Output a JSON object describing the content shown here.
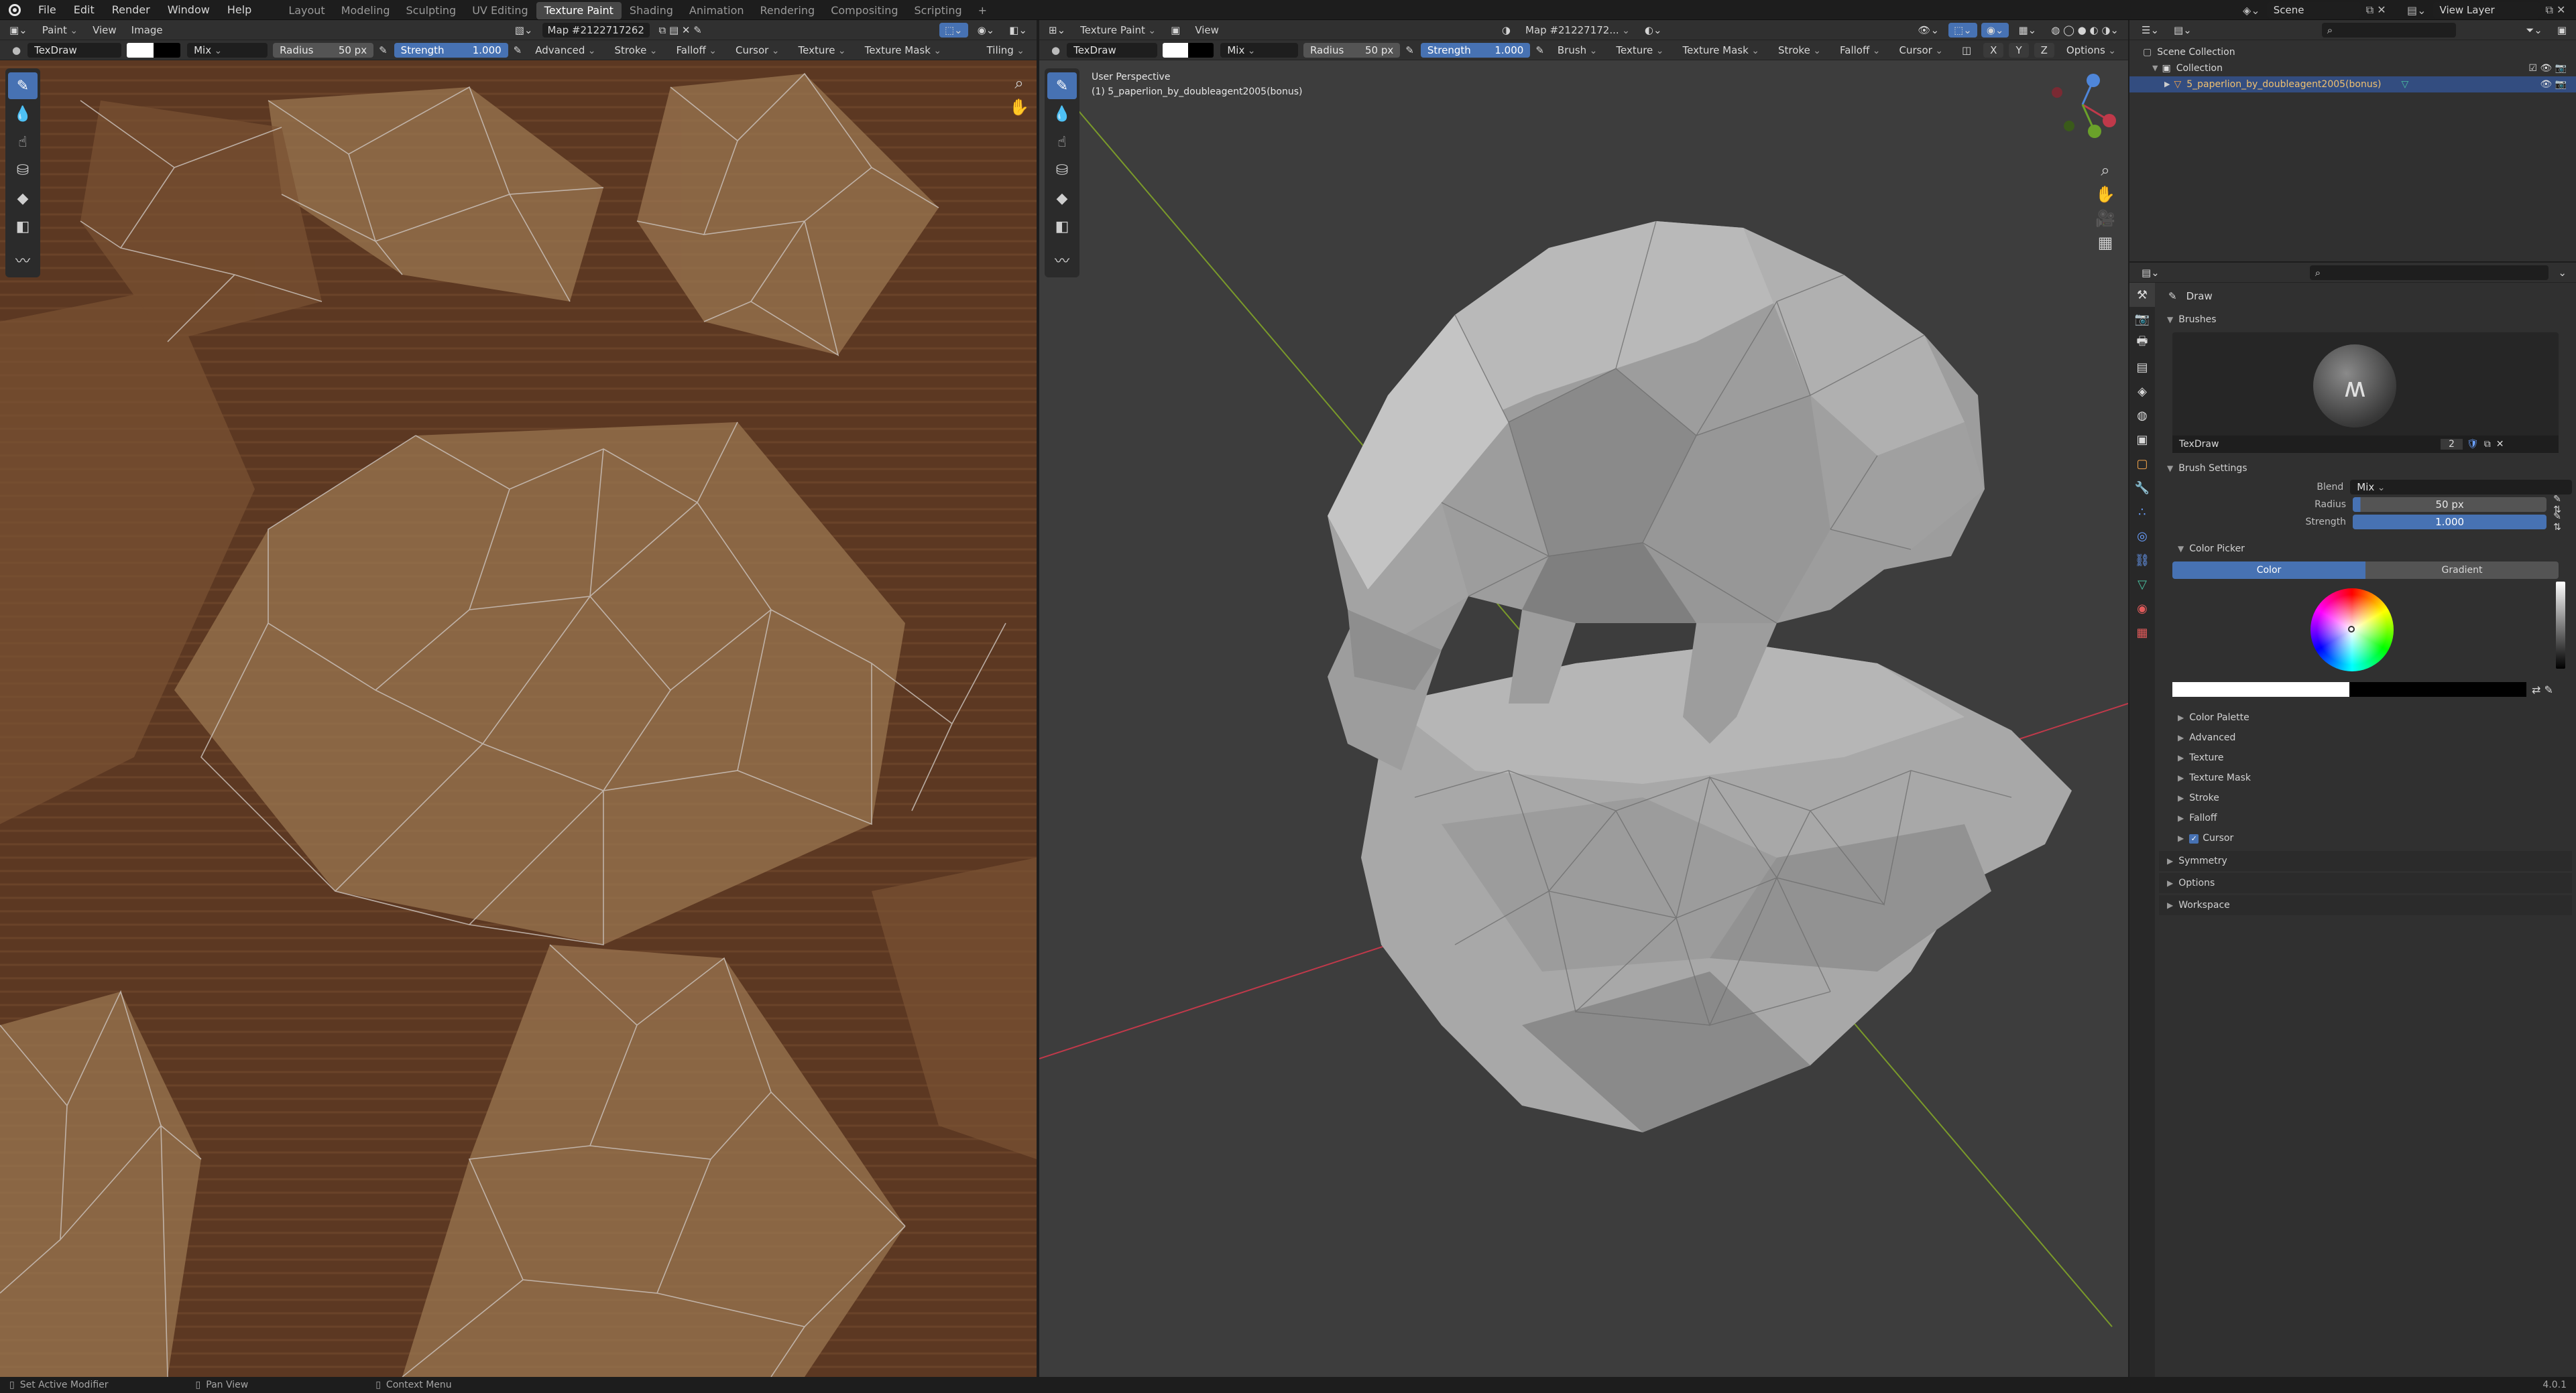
{
  "topbar": {
    "menus": [
      "File",
      "Edit",
      "Render",
      "Window",
      "Help"
    ],
    "workspaces": [
      "Layout",
      "Modeling",
      "Sculpting",
      "UV Editing",
      "Texture Paint",
      "Shading",
      "Animation",
      "Rendering",
      "Compositing",
      "Scripting"
    ],
    "active_workspace": "Texture Paint",
    "add_tab": "+",
    "scene": "Scene",
    "view_layer": "View Layer"
  },
  "image_editor": {
    "mode": "Paint",
    "menus": [
      "View",
      "Image"
    ],
    "image_name": "Map #2122717262",
    "tiling": "Tiling",
    "tool": {
      "brush": "TexDraw",
      "blend": "Mix",
      "radius_label": "Radius",
      "radius_value": "50 px",
      "strength_label": "Strength",
      "strength_value": "1.000",
      "menus": [
        "Advanced",
        "Stroke",
        "Falloff",
        "Cursor",
        "Texture",
        "Texture Mask"
      ]
    }
  },
  "viewport": {
    "mode": "Texture Paint",
    "menus": [
      "View"
    ],
    "image_name": "Map #21227172...",
    "perspective_label": "User Perspective",
    "object_label": "(1) 5_paperlion_by_doubleagent2005(bonus)",
    "options": "Options",
    "axes": [
      "X",
      "Y",
      "Z"
    ],
    "tool": {
      "brush": "TexDraw",
      "blend": "Mix",
      "radius_label": "Radius",
      "radius_value": "50 px",
      "strength_label": "Strength",
      "strength_value": "1.000",
      "menus": [
        "Brush",
        "Texture",
        "Texture Mask",
        "Stroke",
        "Falloff",
        "Cursor"
      ]
    }
  },
  "outliner": {
    "scene_collection": "Scene Collection",
    "collection": "Collection",
    "object": "5_paperlion_by_doubleagent2005(bonus)"
  },
  "properties": {
    "tool_name": "Draw",
    "brushes_header": "Brushes",
    "brush_name": "TexDraw",
    "brush_users": "2",
    "brush_settings_header": "Brush Settings",
    "blend_label": "Blend",
    "blend_value": "Mix",
    "radius_label": "Radius",
    "radius_value": "50 px",
    "strength_label": "Strength",
    "strength_value": "1.000",
    "color_picker_header": "Color Picker",
    "color_tab": "Color",
    "gradient_tab": "Gradient",
    "subpanels": [
      "Color Palette",
      "Advanced",
      "Texture",
      "Texture Mask",
      "Stroke",
      "Falloff",
      "Cursor"
    ],
    "sections": [
      "Symmetry",
      "Options",
      "Workspace"
    ]
  },
  "statusbar": {
    "hint1": "Set Active Modifier",
    "hint2": "Pan View",
    "hint3": "Context Menu",
    "version": "4.0.1"
  },
  "colors": {
    "accent": "#4772b3",
    "texture_brown": "#5a3622",
    "viewport_bg": "#3d3d3d",
    "x_axis": "#c0394a",
    "y_axis": "#7a9a2a"
  }
}
